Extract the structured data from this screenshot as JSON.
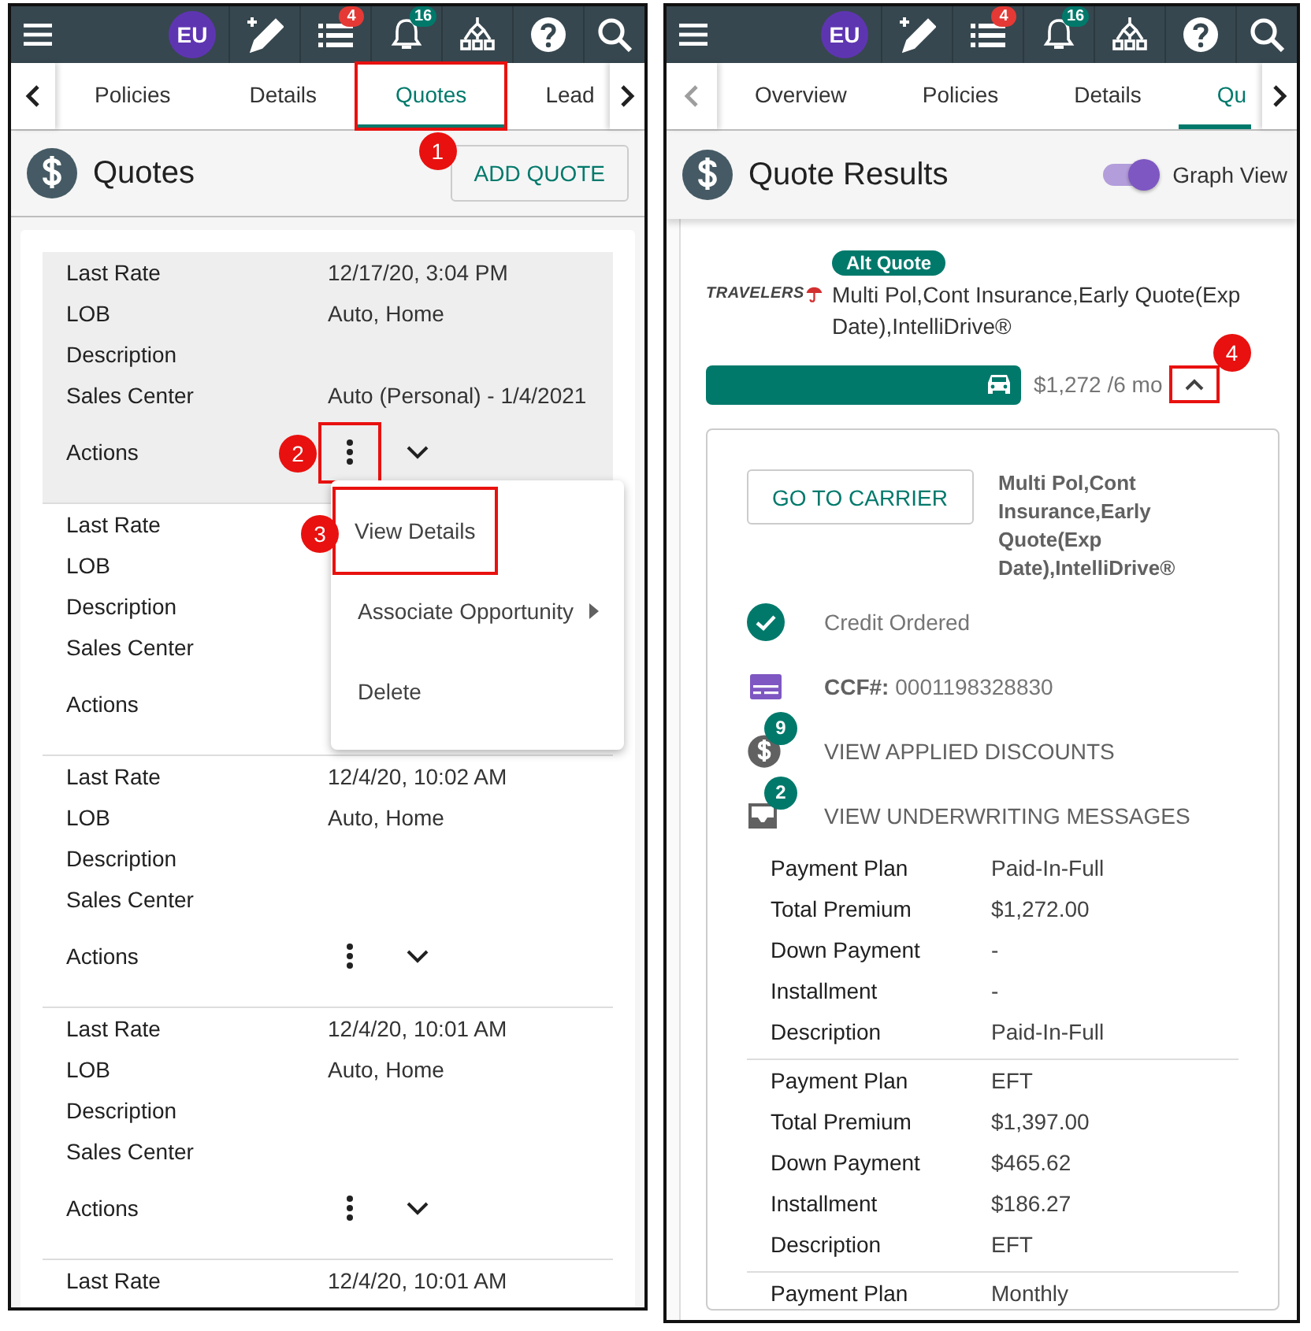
{
  "left": {
    "header": {
      "avatar": "EU",
      "list_badge": "4",
      "bell_badge": "16"
    },
    "back_disabled": false,
    "tabs": [
      {
        "label": "Policies",
        "selected": false
      },
      {
        "label": "Details",
        "selected": false
      },
      {
        "label": "Quotes",
        "selected": true,
        "callout": "1"
      },
      {
        "label": "Lead",
        "selected": false
      }
    ],
    "title": "Quotes",
    "add_button": "ADD QUOTE",
    "quotes": [
      {
        "selected": true,
        "fields": [
          {
            "label": "Last Rate",
            "value": "12/17/20, 3:04 PM"
          },
          {
            "label": "LOB",
            "value": "Auto, Home"
          },
          {
            "label": "Description"
          },
          {
            "label": "Sales Center",
            "value": "Auto (Personal) - 1/4/2021"
          }
        ],
        "actions": {
          "label": "Actions",
          "buttons": true,
          "callout": "2"
        }
      },
      {
        "selected": false,
        "fields": [
          {
            "label": "Last Rate"
          },
          {
            "label": "LOB"
          },
          {
            "label": "Description"
          },
          {
            "label": "Sales Center"
          }
        ],
        "actions": {
          "label": "Actions"
        }
      },
      {
        "selected": false,
        "fields": [
          {
            "label": "Last Rate",
            "value": "12/4/20, 10:02 AM"
          },
          {
            "label": "LOB",
            "value": "Auto, Home"
          },
          {
            "label": "Description"
          },
          {
            "label": "Sales Center"
          }
        ],
        "actions": {
          "label": "Actions",
          "buttons": true
        }
      },
      {
        "selected": false,
        "fields": [
          {
            "label": "Last Rate",
            "value": "12/4/20, 10:01 AM"
          },
          {
            "label": "LOB",
            "value": "Auto, Home"
          },
          {
            "label": "Description"
          },
          {
            "label": "Sales Center"
          }
        ],
        "actions": {
          "label": "Actions",
          "buttons": true
        }
      },
      {
        "selected": false,
        "fields": [
          {
            "label": "Last Rate",
            "value": "12/4/20, 10:01 AM"
          }
        ]
      }
    ],
    "menu": {
      "items": [
        {
          "label": "View Details",
          "submenu": false,
          "callout": "3"
        },
        {
          "label": "Associate Opportunity",
          "submenu": true
        },
        {
          "label": "Delete",
          "submenu": false
        }
      ]
    }
  },
  "right": {
    "header": {
      "avatar": "EU",
      "list_badge": "4",
      "bell_badge": "16"
    },
    "back_disabled": true,
    "tabs": [
      {
        "label": "Overview",
        "selected": false
      },
      {
        "label": "Policies",
        "selected": false
      },
      {
        "label": "Details",
        "selected": false
      },
      {
        "label": "Qu",
        "selected": true
      }
    ],
    "title": "Quote Results",
    "toggle": {
      "label": "Graph View",
      "on": true
    },
    "quote": {
      "badge": "Alt Quote",
      "logo": "TRAVELERS",
      "description": "Multi Pol,Cont Insurance,Early Quote(Exp Date),IntelliDrive®",
      "price": "$1,272",
      "period": "/6 mo",
      "expanded": true,
      "callout": "4",
      "carrier_button": "GO TO CARRIER",
      "discounts_text": "Multi Pol,Cont Insurance,Early Quote(Exp Date),IntelliDrive®",
      "credit": "Credit Ordered",
      "ccf_label": "CCF#:",
      "ccf_value": "0001198328830",
      "links": [
        {
          "kind": "discounts",
          "label": "VIEW APPLIED DISCOUNTS",
          "count": "9"
        },
        {
          "kind": "messages",
          "label": "VIEW UNDERWRITING MESSAGES",
          "count": "2"
        }
      ],
      "plans": [
        {
          "fields": [
            {
              "label": "Payment Plan",
              "value": "Paid-In-Full"
            },
            {
              "label": "Total Premium",
              "value": "$1,272.00"
            },
            {
              "label": "Down Payment",
              "value": "-"
            },
            {
              "label": "Installment",
              "value": "-"
            },
            {
              "label": "Description",
              "value": "Paid-In-Full"
            }
          ]
        },
        {
          "fields": [
            {
              "label": "Payment Plan",
              "value": "EFT"
            },
            {
              "label": "Total Premium",
              "value": "$1,397.00"
            },
            {
              "label": "Down Payment",
              "value": "$465.62"
            },
            {
              "label": "Installment",
              "value": "$186.27"
            },
            {
              "label": "Description",
              "value": "EFT"
            }
          ]
        },
        {
          "fields": [
            {
              "label": "Payment Plan",
              "value": "Monthly"
            }
          ]
        }
      ]
    }
  }
}
